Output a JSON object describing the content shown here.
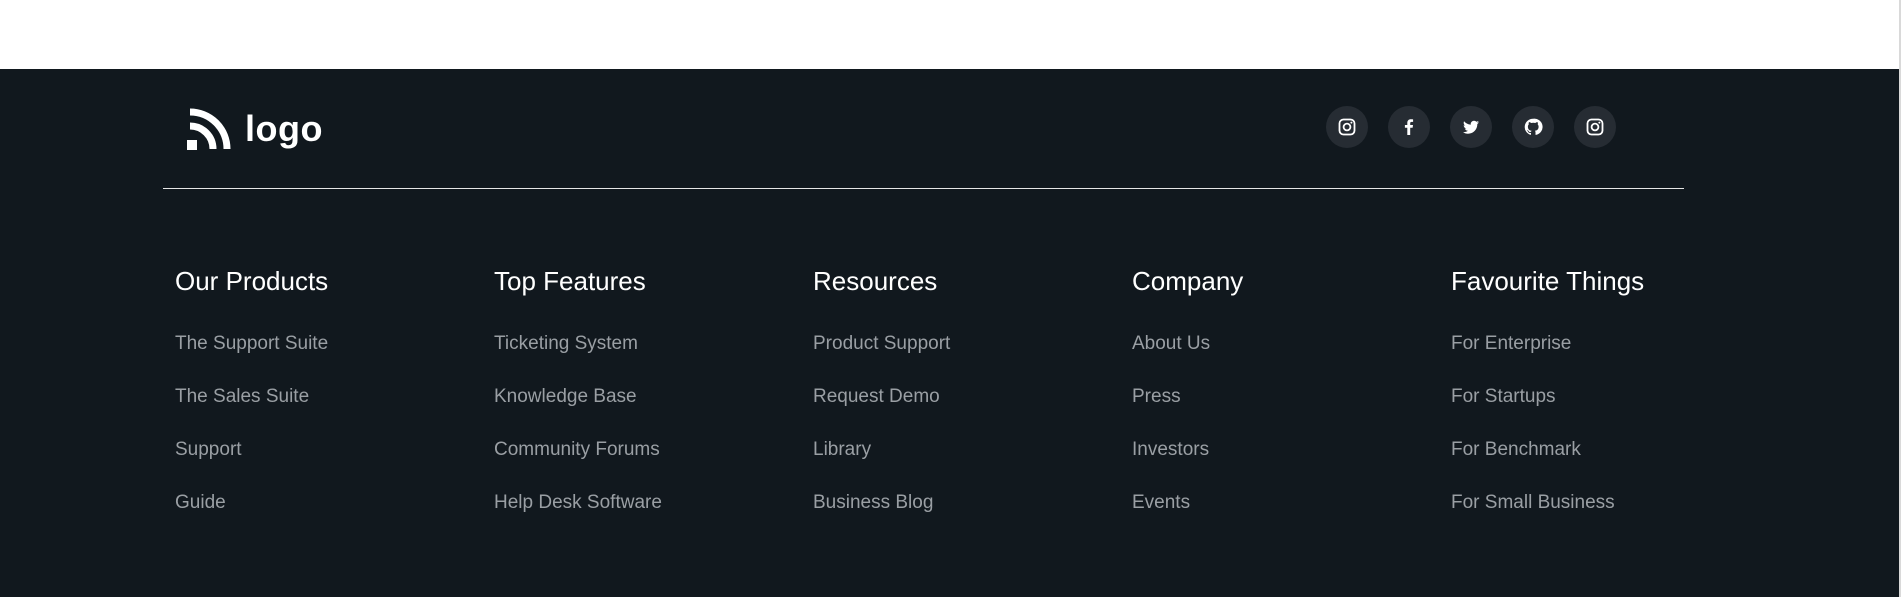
{
  "logo": {
    "text": "logo",
    "icon": "logo-arcs-icon"
  },
  "social": [
    {
      "name": "instagram",
      "icon": "instagram-icon"
    },
    {
      "name": "facebook",
      "icon": "facebook-icon"
    },
    {
      "name": "twitter",
      "icon": "twitter-icon"
    },
    {
      "name": "github",
      "icon": "github-icon"
    },
    {
      "name": "instagram",
      "icon": "instagram-icon"
    }
  ],
  "columns": [
    {
      "heading": "Our Products",
      "links": [
        "The Support Suite",
        "The Sales Suite",
        "Support",
        "Guide"
      ]
    },
    {
      "heading": "Top Features",
      "links": [
        "Ticketing System",
        "Knowledge Base",
        "Community Forums",
        "Help Desk Software"
      ]
    },
    {
      "heading": "Resources",
      "links": [
        "Product Support",
        "Request Demo",
        "Library",
        "Business Blog"
      ]
    },
    {
      "heading": "Company",
      "links": [
        "About Us",
        "Press",
        "Investors",
        "Events"
      ]
    },
    {
      "heading": "Favourite Things",
      "links": [
        "For Enterprise",
        "For Startups",
        "For Benchmark",
        "For Small Business"
      ]
    }
  ],
  "colors": {
    "footer_bg": "#11181e",
    "heading": "#ffffff",
    "link": "#9a9fa4",
    "social_bg": "#262c33",
    "divider": "#e6e6e6"
  }
}
